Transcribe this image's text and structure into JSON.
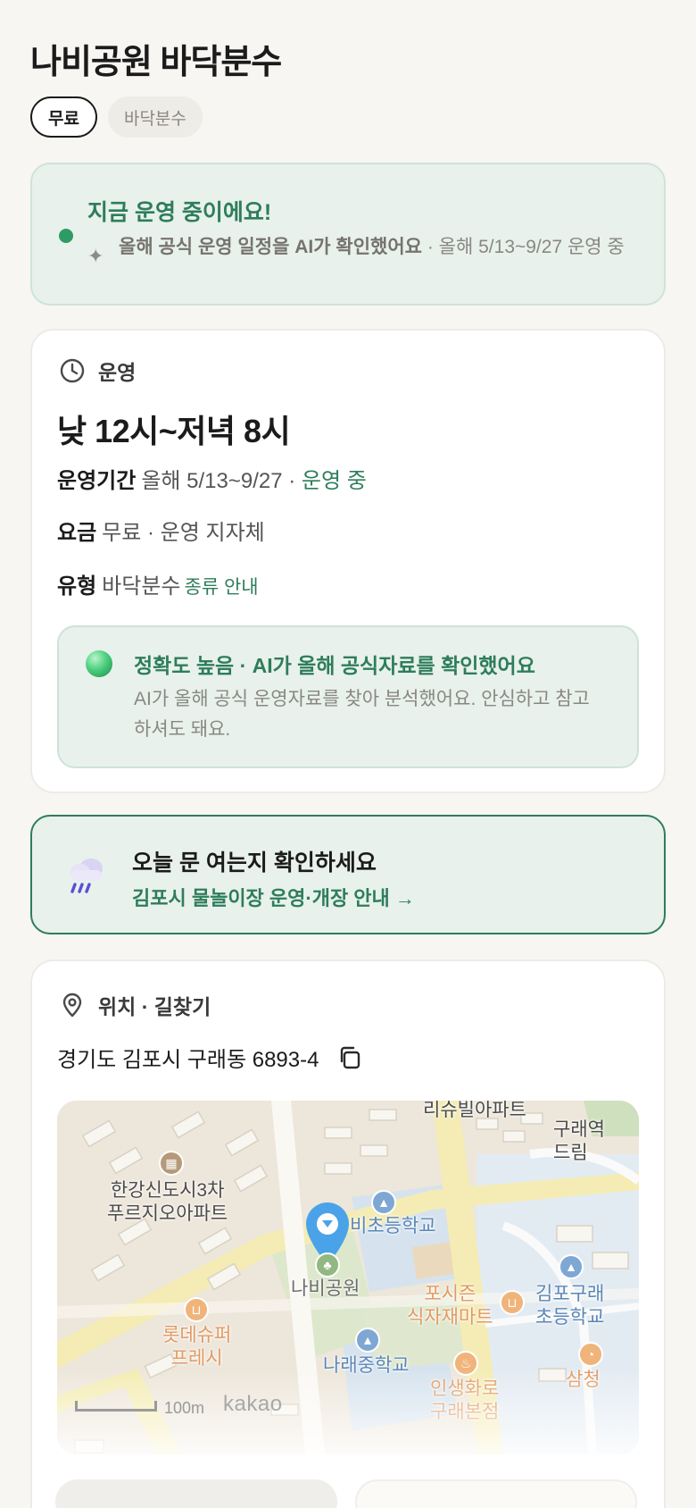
{
  "page": {
    "title": "나비공원 바닥분수",
    "tags": [
      "무료",
      "바닥분수"
    ]
  },
  "status": {
    "headline": "지금 운영 중이에요!",
    "sub_strong": "올해 공식 운영 일정을 AI가 확인했어요",
    "sub_rest": " · 올해 5/13~9/27 운영 중"
  },
  "operation": {
    "section_title": "운영",
    "hours": "낮 12시~저녁 8시",
    "period_key": "운영기간",
    "period_value": "올해 5/13~9/27 · ",
    "period_status": "운영 중",
    "fee_key": "요금",
    "fee_value": "무료 · 운영 지자체",
    "type_key": "유형",
    "type_value": "바닥분수",
    "type_link": "종류 안내",
    "accuracy": {
      "headline": "정확도 높음 · AI가 올해 공식자료를 확인했어요",
      "body": "AI가 올해 공식 운영자료를 찾아 분석했어요. 안심하고 참고하셔도 돼요."
    }
  },
  "notice": {
    "headline": "오늘 문 여는지 확인하세요",
    "link": "김포시 물놀이장 운영·개장 안내 →",
    "icon": "rain-cloud-icon"
  },
  "location": {
    "section_title": "위치 · 길찾기",
    "address": "경기도 김포시 구래동 6893-4",
    "map": {
      "labels": {
        "apt1": "한강신도시3차\n푸르지오아파트",
        "apt2": "리슈빌아파트",
        "school1": "비초등학교",
        "park": "나비공원",
        "mart1": "롯데슈퍼\n프레시",
        "school2": "나래중학교",
        "mart2": "포시즌\n식자재마트",
        "school3": "김포구래\n초등학교",
        "restaurant": "인생화로\n구래본점",
        "edge1": "구래역\n드림",
        "edge2": "삼청"
      },
      "scale": "100m",
      "brand": "kakao"
    }
  },
  "colors": {
    "accent": "#2e7d5b",
    "status_bg": "#e8f1ec",
    "background": "#f7f6f2"
  }
}
